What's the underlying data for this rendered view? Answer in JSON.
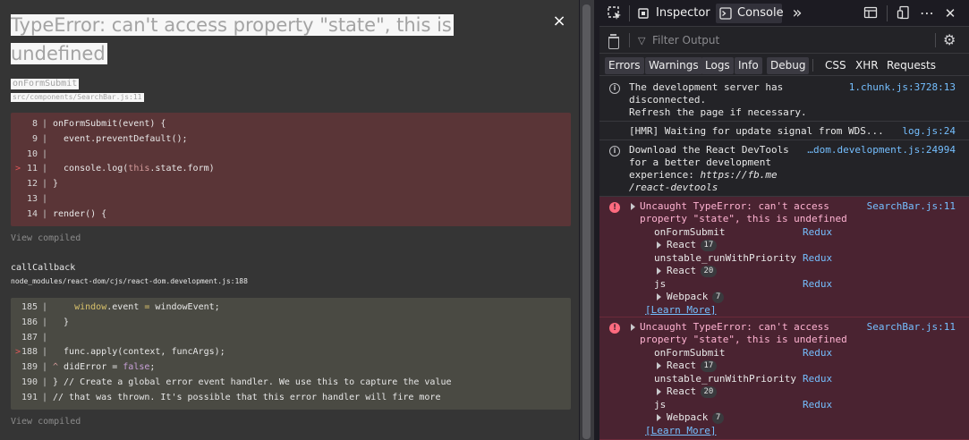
{
  "overlay": {
    "title": "TypeError: can't access property \"state\", this is undefined",
    "close_glyph": "×",
    "frames": [
      {
        "function": "onFormSubmit",
        "file": "src/components/SearchBar.js:11",
        "lines": [
          {
            "num": "8",
            "code": "onFormSubmit(event) {",
            "marked": false
          },
          {
            "num": "9",
            "code": "  event.preventDefault();",
            "marked": false
          },
          {
            "num": "10",
            "code": "",
            "marked": false
          },
          {
            "num": "11",
            "code": "  console.log(this.state.form)",
            "marked": true
          },
          {
            "num": "12",
            "code": "}",
            "marked": false
          },
          {
            "num": "13",
            "code": "",
            "marked": false
          },
          {
            "num": "14",
            "code": "render() {",
            "marked": false
          }
        ],
        "view_compiled": "View compiled"
      },
      {
        "function": "callCallback",
        "file": "node_modules/react-dom/cjs/react-dom.development.js:188",
        "lines": [
          {
            "num": "185",
            "code": "    window.event = windowEvent;",
            "marked": false
          },
          {
            "num": "186",
            "code": "  }",
            "marked": false
          },
          {
            "num": "187",
            "code": "",
            "marked": false
          },
          {
            "num": "188",
            "code": "  func.apply(context, funcArgs);",
            "marked": true
          },
          {
            "num": "189",
            "code": "^ didError = false;",
            "marked": false
          },
          {
            "num": "190",
            "code": "} // Create a global error event handler. We use this to capture the value",
            "marked": false
          },
          {
            "num": "191",
            "code": "// that was thrown. It's possible that this error handler will fire more",
            "marked": false
          }
        ],
        "view_compiled": "View compiled"
      }
    ],
    "marker_glyph": ">"
  },
  "devtools": {
    "tabs": {
      "inspector": "Inspector",
      "console": "Console",
      "more": "»"
    },
    "filter": {
      "placeholder": "Filter Output"
    },
    "levels": [
      "Errors",
      "Warnings",
      "Logs",
      "Info",
      "Debug"
    ],
    "types": [
      "CSS",
      "XHR",
      "Requests"
    ],
    "messages": [
      {
        "kind": "info",
        "text": "The development server has\ndisconnected.\nRefresh the page if necessary.",
        "source": "1.chunk.js:3728:13"
      },
      {
        "kind": "log",
        "text": "[HMR] Waiting for update signal from WDS...",
        "source": "log.js:24"
      },
      {
        "kind": "info",
        "text_plain": "Download the React DevTools\nfor a better development\nexperience: ",
        "text_italic": "https://fb.me\n/react-devtools",
        "source": "…dom.development.js:24994"
      }
    ],
    "errors": [
      {
        "message": "Uncaught TypeError: can't access\nproperty \"state\", this is undefined",
        "source": "SearchBar.js:11",
        "stack": [
          {
            "fn": "onFormSubmit",
            "link": "Redux"
          },
          {
            "group": "React",
            "count": "17"
          },
          {
            "fn": "unstable_runWithPriority",
            "link": "Redux"
          },
          {
            "group": "React",
            "count": "20"
          },
          {
            "fn": "js",
            "link": "Redux"
          },
          {
            "group": "Webpack",
            "count": "7"
          }
        ],
        "learn_more": "[Learn More]"
      },
      {
        "message": "Uncaught TypeError: can't access\nproperty \"state\", this is undefined",
        "source": "SearchBar.js:11",
        "stack": [
          {
            "fn": "onFormSubmit",
            "link": "Redux"
          },
          {
            "group": "React",
            "count": "17"
          },
          {
            "fn": "unstable_runWithPriority",
            "link": "Redux"
          },
          {
            "group": "React",
            "count": "20"
          },
          {
            "fn": "js",
            "link": "Redux"
          },
          {
            "group": "Webpack",
            "count": "7"
          }
        ],
        "learn_more": "[Learn More]"
      }
    ]
  }
}
